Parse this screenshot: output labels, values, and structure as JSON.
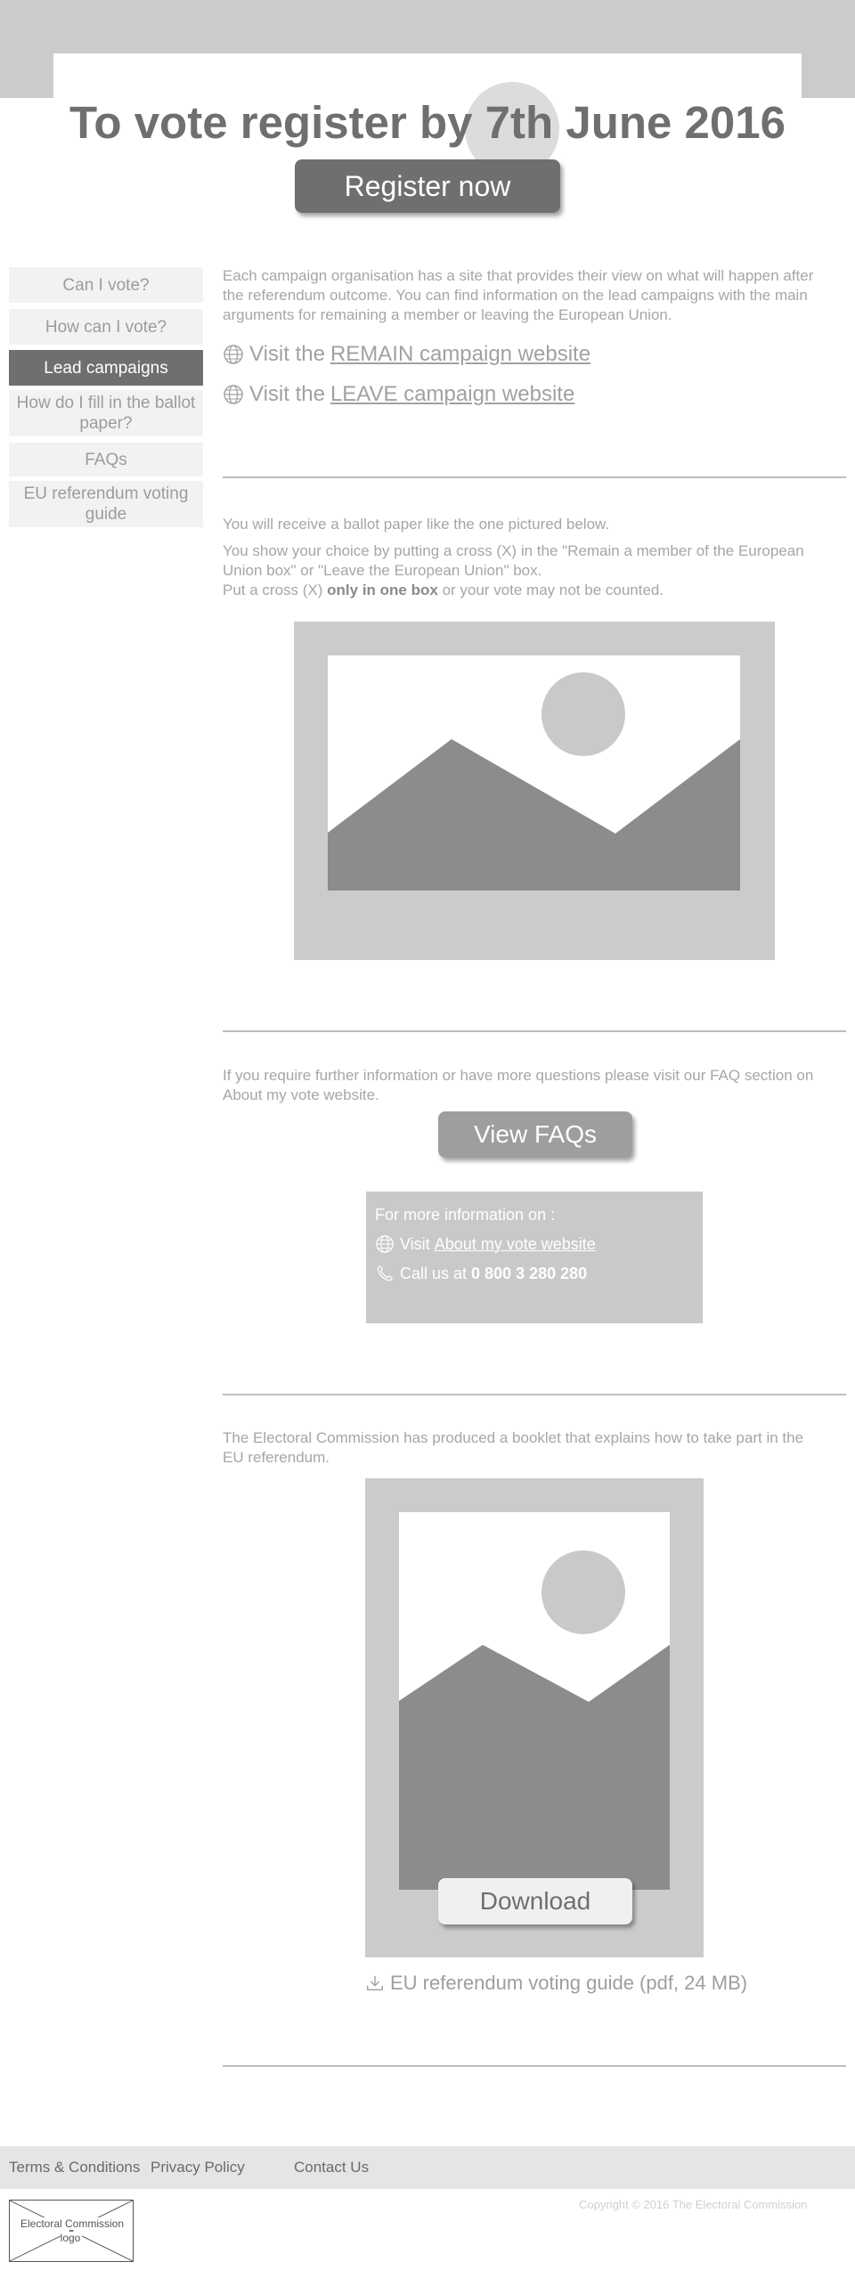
{
  "hero": {
    "title": "To vote register by 7th June 2016",
    "register_label": "Register now"
  },
  "nav": {
    "items": [
      {
        "label": "Can I vote?",
        "active": false
      },
      {
        "label": "How can I vote?",
        "active": false
      },
      {
        "label": "Lead campaigns",
        "active": true
      },
      {
        "label": "How do I fill in the ballot paper?",
        "active": false
      },
      {
        "label": "FAQs",
        "active": false
      },
      {
        "label": "EU referendum voting guide",
        "active": false
      }
    ]
  },
  "campaigns": {
    "intro": "Each campaign organisation has a site that provides their view on what will happen after the referendum outcome. You can find information on the lead campaigns with the main arguments for remaining a member or leaving the European Union.",
    "visit_prefix": "Visit the",
    "remain_link": "REMAIN campaign website",
    "leave_link": "LEAVE campaign website"
  },
  "ballot": {
    "line1": "You will receive a ballot paper  like the one pictured below.",
    "line2": "You show your choice by putting a cross (X) in the \"Remain a member of the European Union box\" or \"Leave the European Union\" box.",
    "line3_pre": "Put a cross (X)",
    "line3_bold": "only in one box",
    "line3_post": "or your vote may not be counted."
  },
  "faq": {
    "intro": "If you require further information or have more questions please visit our FAQ section on About my vote website.",
    "button_label": "View FAQs",
    "info_title": "For more information on :",
    "visit_prefix": "Visit",
    "visit_link": "About my vote website",
    "call_prefix": "Call us at",
    "phone": "0 800 3 280 280"
  },
  "booklet": {
    "intro": "The Electoral Commission has produced a booklet that explains how to take part in the EU referendum.",
    "download_label": "Download",
    "guide_label": "EU referendum voting guide (pdf, 24 MB)"
  },
  "footer": {
    "terms": "Terms & Conditions",
    "privacy": "Privacy Policy",
    "contact": "Contact Us",
    "logo_label": "Electoral Commission logo",
    "copyright": "Copyright © 2016 The Electoral Commission"
  },
  "icons": [
    "globe-icon",
    "phone-icon",
    "download-icon",
    "image-placeholder-icon"
  ],
  "colors": {
    "dark_button": "#6f6f6f",
    "mid_button": "#9e9e9e",
    "panel_grey": "#cbcbcb",
    "nav_bg": "#f2f2f2",
    "footer_bg": "#e5e5e5"
  }
}
